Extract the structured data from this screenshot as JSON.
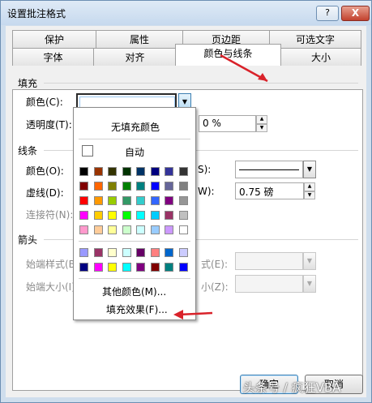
{
  "window": {
    "title": "设置批注格式",
    "help": "?",
    "close": "X"
  },
  "tabs_back": [
    "保护",
    "属性",
    "页边距",
    "可选文字"
  ],
  "tabs_front": [
    "字体",
    "对齐",
    "颜色与线条",
    "大小"
  ],
  "fill": {
    "section": "填充",
    "color_label": "颜色(C):",
    "transparency_label": "透明度(T):",
    "transparency_value": "0 %"
  },
  "line": {
    "section": "线条",
    "color_label": "颜色(O):",
    "style_label": "S):",
    "dash_label": "虚线(D):",
    "weight_label": "W):",
    "weight_value": "0.75 磅",
    "connector_label": "连接符(N):"
  },
  "arrows": {
    "section": "箭头",
    "begin_style_label": "始端样式(B)",
    "end_style_label": "式(E):",
    "begin_size_label": "始端大小(I):",
    "end_size_label": "小(Z):"
  },
  "popup": {
    "no_fill": "无填充颜色",
    "automatic": "自动",
    "more_colors": "其他颜色(M)...",
    "fill_effects": "填充效果(F)...",
    "standard_colors": [
      [
        "#000000",
        "#993300",
        "#333300",
        "#003300",
        "#003366",
        "#000080",
        "#333399",
        "#333333"
      ],
      [
        "#800000",
        "#ff6600",
        "#808000",
        "#008000",
        "#008080",
        "#0000ff",
        "#666699",
        "#808080"
      ],
      [
        "#ff0000",
        "#ff9900",
        "#99cc00",
        "#339966",
        "#33cccc",
        "#3366ff",
        "#800080",
        "#969696"
      ],
      [
        "#ff00ff",
        "#ffcc00",
        "#ffff00",
        "#00ff00",
        "#00ffff",
        "#00ccff",
        "#993366",
        "#c0c0c0"
      ],
      [
        "#ff99cc",
        "#ffcc99",
        "#ffff99",
        "#ccffcc",
        "#ccffff",
        "#99ccff",
        "#cc99ff",
        "#ffffff"
      ]
    ],
    "extra_colors": [
      [
        "#9999ff",
        "#993366",
        "#ffffcc",
        "#ccffff",
        "#660066",
        "#ff8080",
        "#0066cc",
        "#ccccff"
      ],
      [
        "#000080",
        "#ff00ff",
        "#ffff00",
        "#00ffff",
        "#800080",
        "#800000",
        "#008080",
        "#0000ff"
      ]
    ]
  },
  "buttons": {
    "ok": "确定",
    "cancel": "取消"
  },
  "watermark": "头条号 / 疯狂VBA",
  "annotation_color": "#d9222a"
}
